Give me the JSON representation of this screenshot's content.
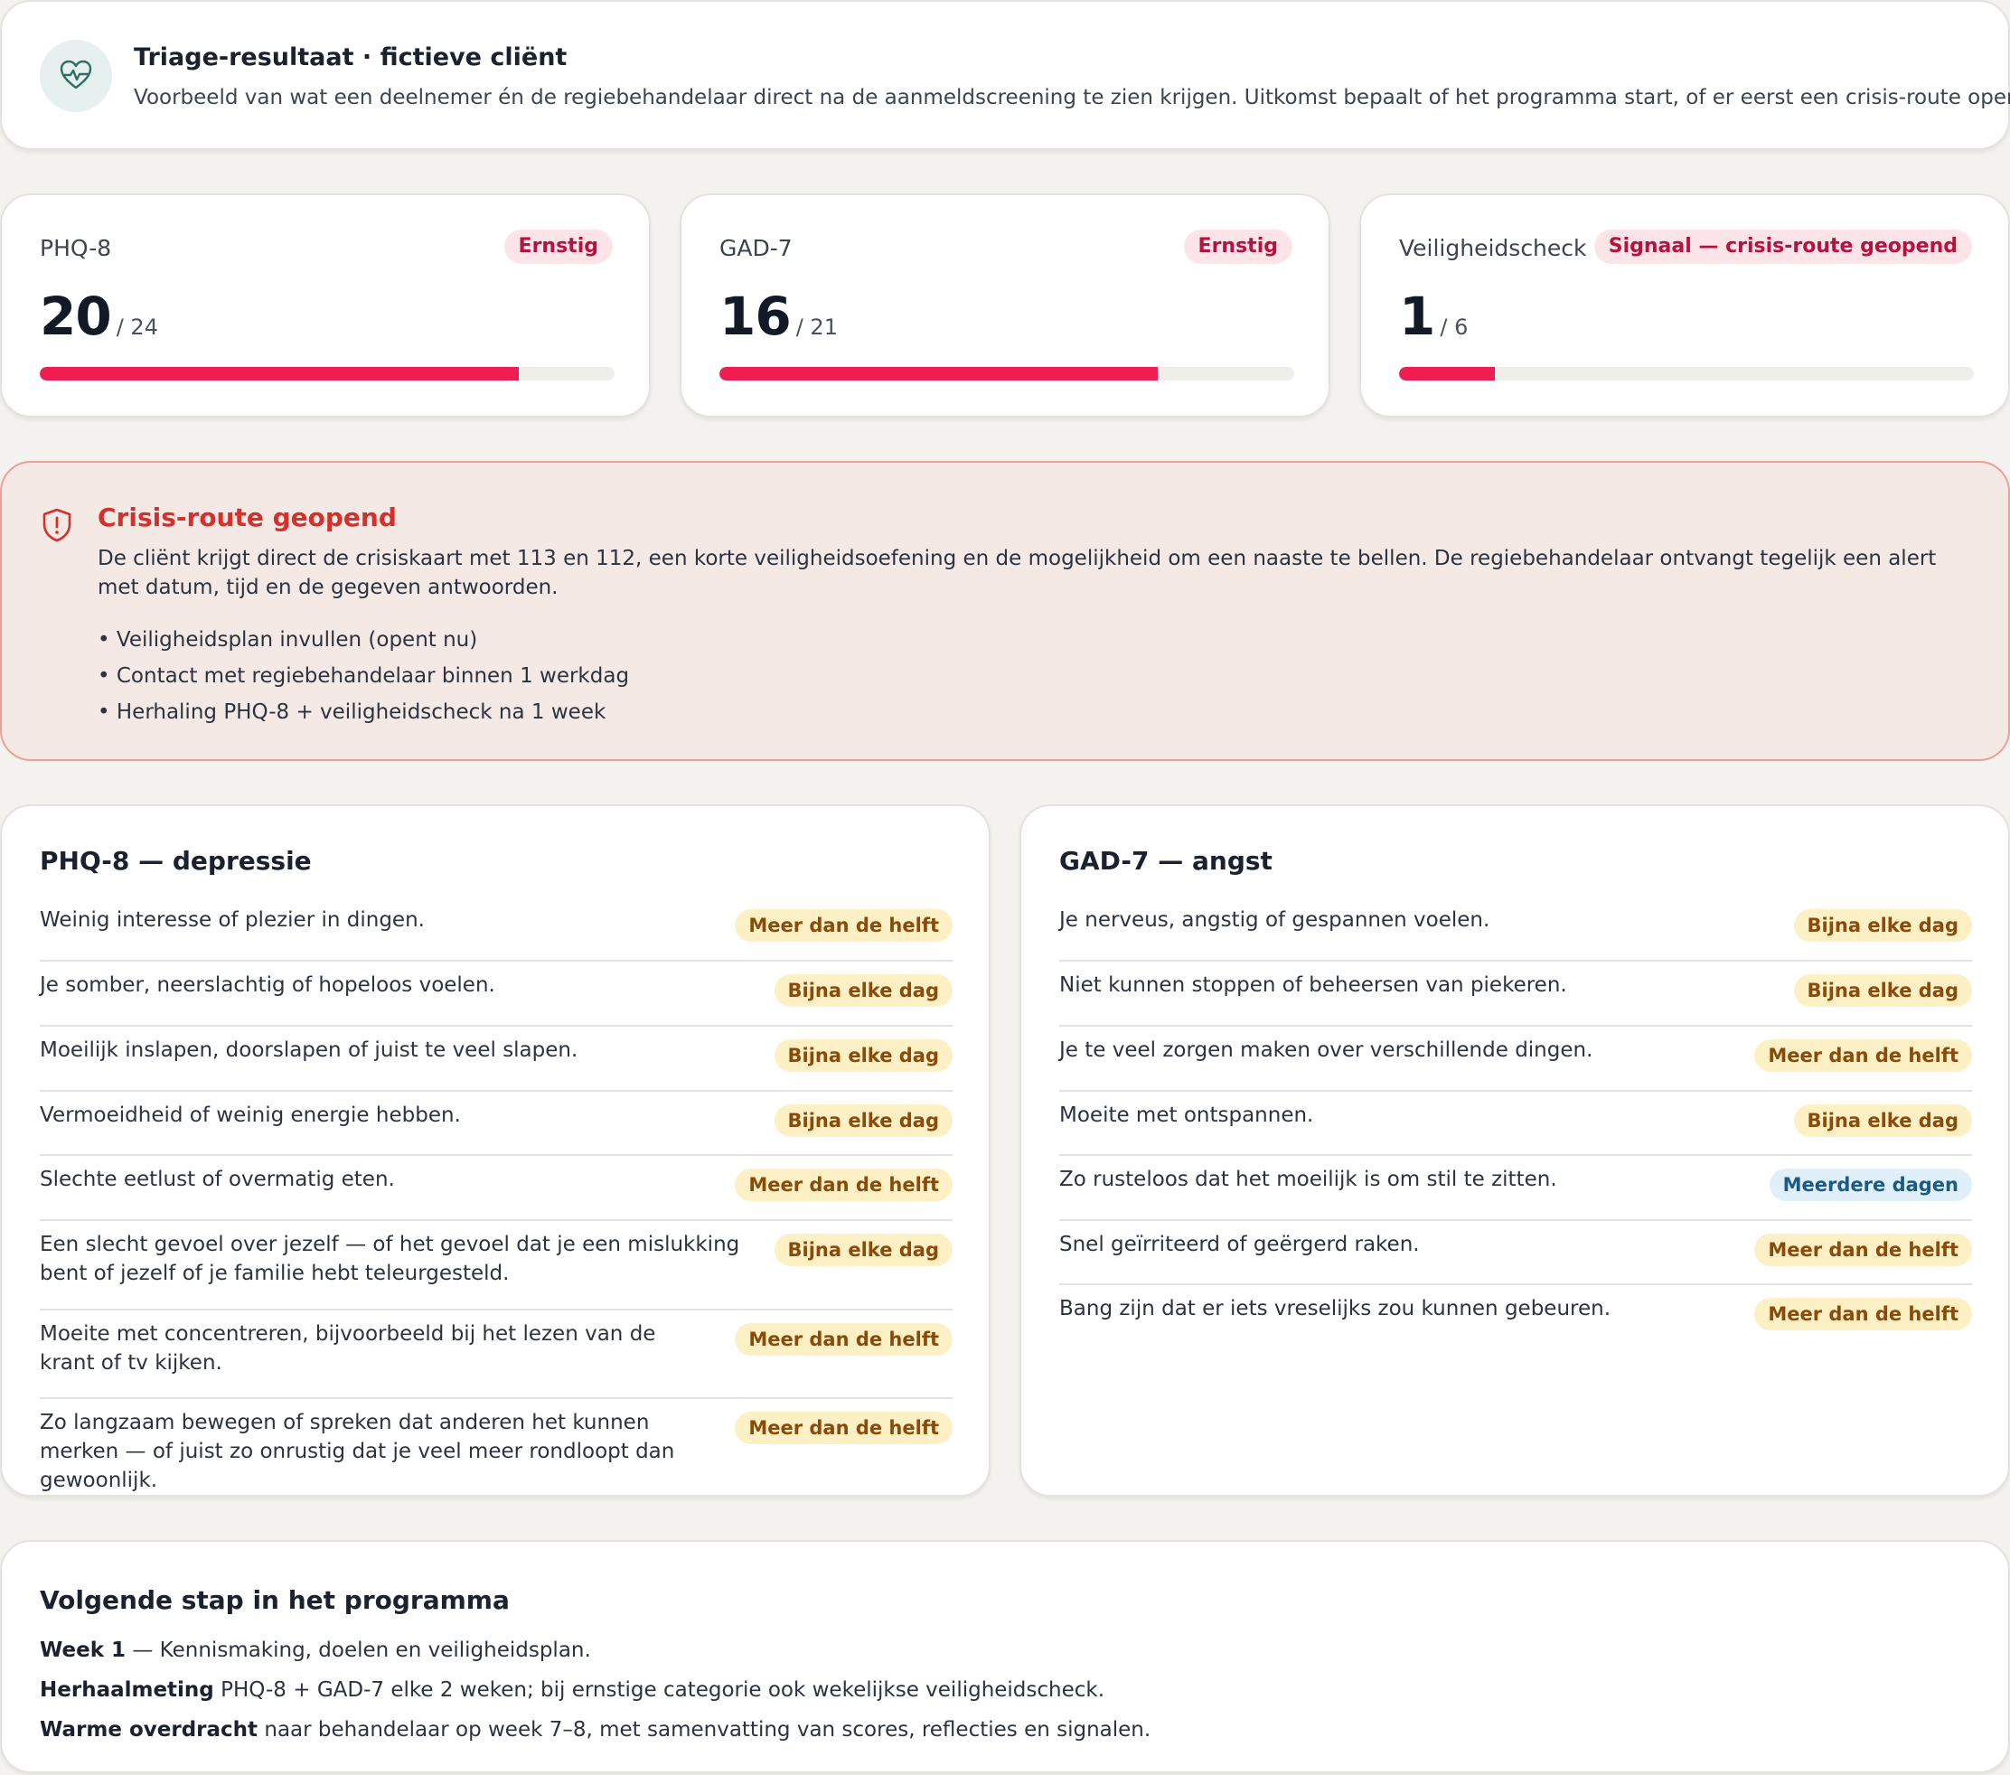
{
  "header": {
    "icon": "heart-pulse-icon",
    "title": "Triage-resultaat · fictieve cliënt",
    "subtitle": "Voorbeeld van wat een deelnemer én de regiebehandelaar direct na de aanmeldscreening te zien krijgen. Uitkomst bepaalt of het programma start, of er eerst een crisis-route open gaat."
  },
  "scores": [
    {
      "label": "PHQ-8",
      "badge": "Ernstig",
      "value": "20",
      "max": "/ 24",
      "fraction": 0.833
    },
    {
      "label": "GAD-7",
      "badge": "Ernstig",
      "value": "16",
      "max": "/ 21",
      "fraction": 0.762
    },
    {
      "label": "Veiligheidscheck",
      "badge": "Signaal — crisis-route geopend",
      "value": "1",
      "max": "/ 6",
      "fraction": 0.167
    }
  ],
  "colors": {
    "accent": "#f01d52",
    "crisis": "#d5302b",
    "teal": "#2f6f68"
  },
  "crisis": {
    "icon": "shield-alert-icon",
    "title": "Crisis-route geopend",
    "text": "De cliënt krijgt direct de crisiskaart met 113 en 112, een korte veiligheidsoefening en de mogelijkheid om een naaste te bellen. De regiebehandelaar ontvangt tegelijk een alert met datum, tijd en de gegeven antwoorden.",
    "items": [
      "• Veiligheidsplan invullen (opent nu)",
      "• Contact met regiebehandelaar binnen 1 werkdag",
      "• Herhaling PHQ-8 + veiligheidscheck na 1 week"
    ]
  },
  "phq": {
    "title": "PHQ-8 — depressie",
    "rows": [
      {
        "q": "Weinig interesse of plezier in dingen.",
        "a": "Meer dan de helft",
        "tone": "amber"
      },
      {
        "q": "Je somber, neerslachtig of hopeloos voelen.",
        "a": "Bijna elke dag",
        "tone": "amber"
      },
      {
        "q": "Moeilijk inslapen, doorslapen of juist te veel slapen.",
        "a": "Bijna elke dag",
        "tone": "amber"
      },
      {
        "q": "Vermoeidheid of weinig energie hebben.",
        "a": "Bijna elke dag",
        "tone": "amber"
      },
      {
        "q": "Slechte eetlust of overmatig eten.",
        "a": "Meer dan de helft",
        "tone": "amber"
      },
      {
        "q": "Een slecht gevoel over jezelf — of het gevoel dat je een mislukking bent of jezelf of je familie hebt teleurgesteld.",
        "a": "Bijna elke dag",
        "tone": "amber"
      },
      {
        "q": "Moeite met concentreren, bijvoorbeeld bij het lezen van de krant of tv kijken.",
        "a": "Meer dan de helft",
        "tone": "amber"
      },
      {
        "q": "Zo langzaam bewegen of spreken dat anderen het kunnen merken — of juist zo onrustig dat je veel meer rondloopt dan gewoonlijk.",
        "a": "Meer dan de helft",
        "tone": "amber"
      }
    ]
  },
  "gad": {
    "title": "GAD-7 — angst",
    "rows": [
      {
        "q": "Je nerveus, angstig of gespannen voelen.",
        "a": "Bijna elke dag",
        "tone": "amber"
      },
      {
        "q": "Niet kunnen stoppen of beheersen van piekeren.",
        "a": "Bijna elke dag",
        "tone": "amber"
      },
      {
        "q": "Je te veel zorgen maken over verschillende dingen.",
        "a": "Meer dan de helft",
        "tone": "amber"
      },
      {
        "q": "Moeite met ontspannen.",
        "a": "Bijna elke dag",
        "tone": "amber"
      },
      {
        "q": "Zo rusteloos dat het moeilijk is om stil te zitten.",
        "a": "Meerdere dagen",
        "tone": "blue"
      },
      {
        "q": "Snel geïrriteerd of geërgerd raken.",
        "a": "Meer dan de helft",
        "tone": "amber"
      },
      {
        "q": "Bang zijn dat er iets vreselijks zou kunnen gebeuren.",
        "a": "Meer dan de helft",
        "tone": "amber"
      }
    ]
  },
  "next": {
    "title": "Volgende stap in het programma",
    "lines": [
      {
        "bold": "Week 1",
        "rest": " — Kennismaking, doelen en veiligheidsplan."
      },
      {
        "bold": "Herhaalmeting",
        "rest": " PHQ-8 + GAD-7 elke 2 weken; bij ernstige categorie ook wekelijkse veiligheidscheck."
      },
      {
        "bold": "Warme overdracht",
        "rest": " naar behandelaar op week 7–8, met samenvatting van scores, reflecties en signalen."
      }
    ]
  }
}
